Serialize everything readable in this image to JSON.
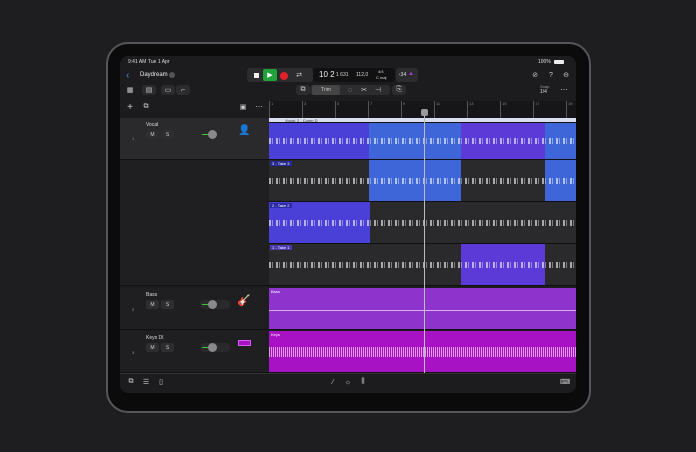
{
  "status": {
    "time": "9:41 AM",
    "date": "Tue 1 Apr",
    "battery": "100%"
  },
  "header": {
    "back_icon": "chevron-left",
    "project": "Daydream"
  },
  "transport": {
    "position": "10 2",
    "sub": "1 631",
    "tempo": "112,0",
    "signature": "4/4",
    "key": "C maj",
    "count_in": "‹34"
  },
  "toolbar": {
    "trim": "Trim",
    "snap_label": "Snap",
    "snap_value": "1/4"
  },
  "ruler": [
    "1",
    "3",
    "5",
    "7",
    "9",
    "11",
    "13",
    "15",
    "17",
    "19"
  ],
  "comp": {
    "label": "Vocal: 2 - Comp D"
  },
  "tracks": [
    {
      "num": "1",
      "name": "Vocal",
      "mute": "M",
      "solo": "S"
    },
    {
      "num": "2",
      "name": "Bass",
      "mute": "M",
      "solo": "S",
      "region": "Bass"
    },
    {
      "num": "3",
      "name": "Keys DI",
      "mute": "M",
      "solo": "S",
      "region": "Keys"
    }
  ],
  "takes": [
    "3 - Take 3",
    "2 - Take 2",
    "1 - Take 1"
  ],
  "colors": {
    "blue": "#3f66d8",
    "violet": "#4a3fd6",
    "purple": "#5b3ad8",
    "bass": "#8e33cc",
    "keys": "#a612c4",
    "play": "#1fa33a"
  }
}
